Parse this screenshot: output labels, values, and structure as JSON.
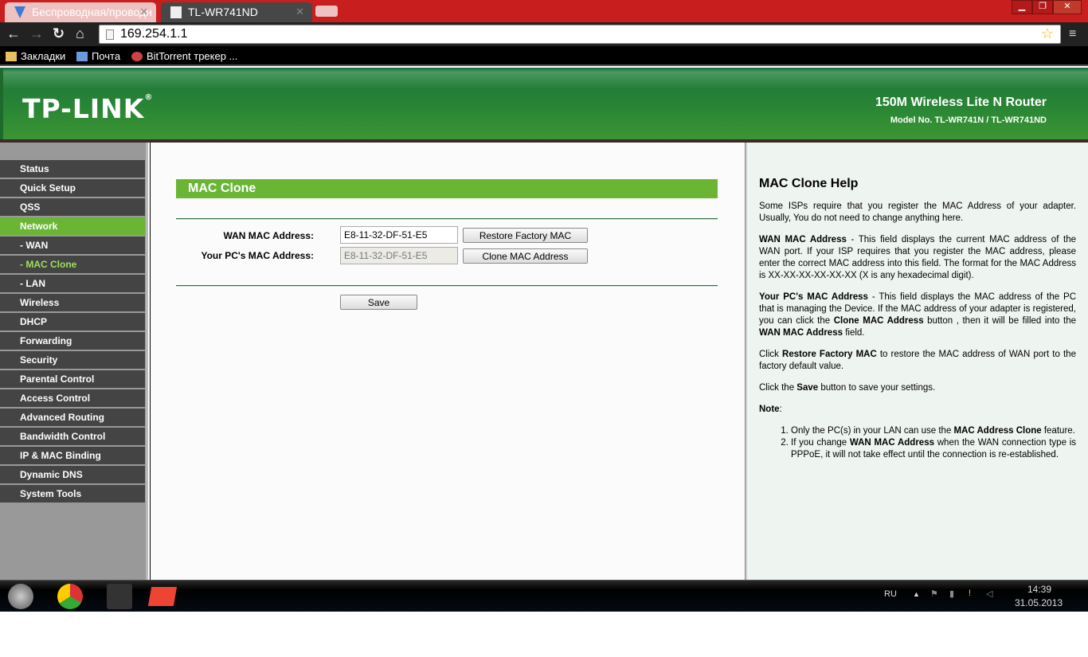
{
  "browser": {
    "tabs": [
      {
        "label": "Беспроводная/проводн"
      },
      {
        "label": "TL-WR741ND"
      }
    ],
    "url": "169.254.1.1",
    "bookmarks": [
      {
        "label": "Закладки"
      },
      {
        "label": "Почта"
      },
      {
        "label": "BitTorrent трекер ..."
      }
    ]
  },
  "header": {
    "logo": "TP-LINK",
    "product": "150M Wireless Lite N Router",
    "model": "Model No. TL-WR741N / TL-WR741ND"
  },
  "sidebar": {
    "items": [
      {
        "label": "Status"
      },
      {
        "label": "Quick Setup"
      },
      {
        "label": "QSS"
      },
      {
        "label": "Network"
      },
      {
        "label": "- WAN"
      },
      {
        "label": "- MAC Clone"
      },
      {
        "label": "- LAN"
      },
      {
        "label": "Wireless"
      },
      {
        "label": "DHCP"
      },
      {
        "label": "Forwarding"
      },
      {
        "label": "Security"
      },
      {
        "label": "Parental Control"
      },
      {
        "label": "Access Control"
      },
      {
        "label": "Advanced Routing"
      },
      {
        "label": "Bandwidth Control"
      },
      {
        "label": "IP & MAC Binding"
      },
      {
        "label": "Dynamic DNS"
      },
      {
        "label": "System Tools"
      }
    ]
  },
  "main": {
    "title": "MAC Clone",
    "wan_label": "WAN MAC Address:",
    "wan_value": "E8-11-32-DF-51-E5",
    "pc_label": "Your PC's MAC Address:",
    "pc_value": "E8-11-32-DF-51-E5",
    "restore_btn": "Restore Factory MAC",
    "clone_btn": "Clone MAC Address",
    "save_btn": "Save"
  },
  "help": {
    "title": "MAC Clone Help",
    "p1": "Some ISPs require that you register the MAC Address of your adapter. Usually, You do not need to change anything here.",
    "p2_b": "WAN MAC Address",
    "p2": " - This field displays the current MAC address of the WAN port. If your ISP requires that you register the MAC address, please enter the correct MAC address into this field. The format for the MAC Address is XX-XX-XX-XX-XX-XX (X is any hexadecimal digit).",
    "p3_b": "Your PC's MAC Address",
    "p3": " - This field displays the MAC address of the PC that is managing the Device. If the MAC address of your adapter is registered, you can click the ",
    "p3_b2": "Clone MAC Address",
    "p3_2": " button , then it will be filled into the ",
    "p3_b3": "WAN MAC Address",
    "p3_3": " field.",
    "p4": "Click ",
    "p4_b": "Restore Factory MAC",
    "p4_2": " to restore the MAC address of WAN port to the factory default value.",
    "p5": "Click the ",
    "p5_b": "Save",
    "p5_2": " button to save your settings.",
    "note": "Note",
    "n1": "Only the PC(s) in your LAN can use the ",
    "n1_b": "MAC Address Clone",
    "n1_2": " feature.",
    "n2": "If you change ",
    "n2_b": "WAN MAC Address",
    "n2_2": " when the WAN connection type is PPPoE, it will not take effect until the connection is re-established."
  },
  "taskbar": {
    "lang": "RU",
    "time": "14:39",
    "date": "31.05.2013"
  }
}
